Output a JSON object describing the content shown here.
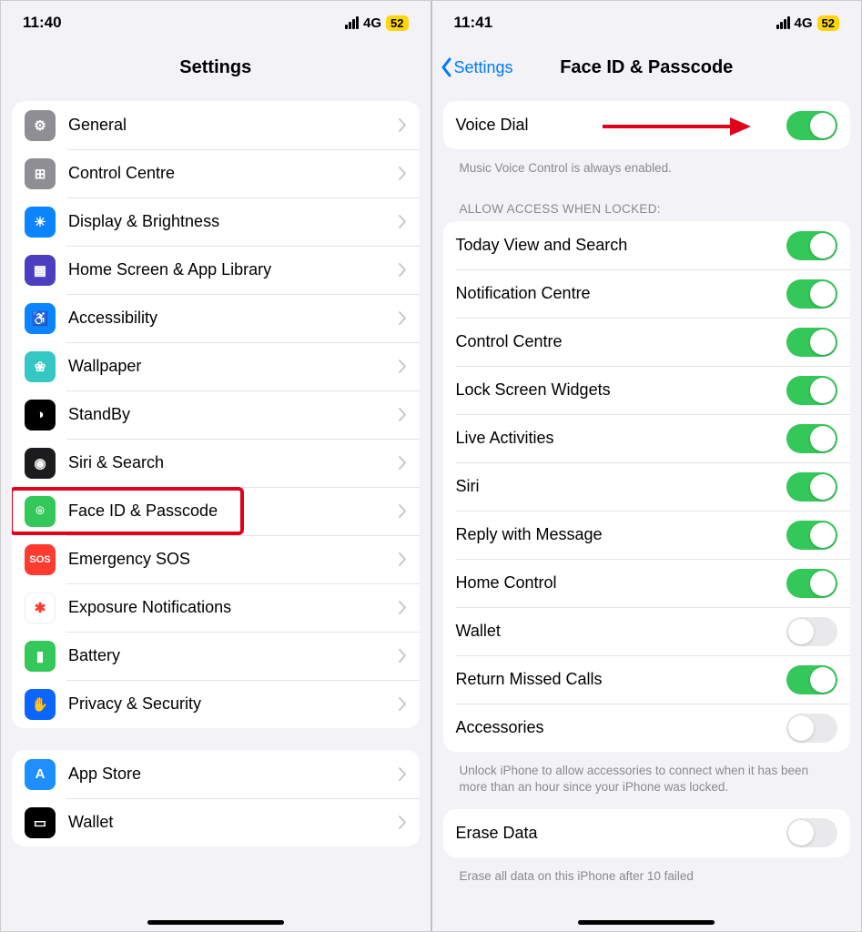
{
  "left": {
    "status": {
      "time": "11:40",
      "network": "4G",
      "battery": "52"
    },
    "title": "Settings",
    "groups": [
      [
        {
          "id": "general",
          "label": "General",
          "icon": "gear-icon",
          "cls": "ic-general",
          "glyph": "⚙"
        },
        {
          "id": "control-centre",
          "label": "Control Centre",
          "icon": "sliders-icon",
          "cls": "ic-control",
          "glyph": "⊞"
        },
        {
          "id": "display",
          "label": "Display & Brightness",
          "icon": "sun-icon",
          "cls": "ic-display",
          "glyph": "☀"
        },
        {
          "id": "home-screen",
          "label": "Home Screen & App Library",
          "icon": "grid-icon",
          "cls": "ic-home",
          "glyph": "▦"
        },
        {
          "id": "accessibility",
          "label": "Accessibility",
          "icon": "person-icon",
          "cls": "ic-access",
          "glyph": "♿"
        },
        {
          "id": "wallpaper",
          "label": "Wallpaper",
          "icon": "flower-icon",
          "cls": "ic-wall",
          "glyph": "❀"
        },
        {
          "id": "standby",
          "label": "StandBy",
          "icon": "clock-icon",
          "cls": "ic-standby",
          "glyph": "◑"
        },
        {
          "id": "siri",
          "label": "Siri & Search",
          "icon": "siri-icon",
          "cls": "ic-siri",
          "glyph": "◉"
        },
        {
          "id": "faceid",
          "label": "Face ID & Passcode",
          "icon": "faceid-icon",
          "cls": "ic-faceid",
          "glyph": "⌾",
          "highlighted": true
        },
        {
          "id": "sos",
          "label": "Emergency SOS",
          "icon": "sos-icon",
          "cls": "ic-sos",
          "glyph": "SOS"
        },
        {
          "id": "exposure",
          "label": "Exposure Notifications",
          "icon": "virus-icon",
          "cls": "ic-exposure",
          "glyph": "✱"
        },
        {
          "id": "battery",
          "label": "Battery",
          "icon": "battery-icon",
          "cls": "ic-battery",
          "glyph": "▮"
        },
        {
          "id": "privacy",
          "label": "Privacy & Security",
          "icon": "hand-icon",
          "cls": "ic-privacy",
          "glyph": "✋"
        }
      ],
      [
        {
          "id": "appstore",
          "label": "App Store",
          "icon": "appstore-icon",
          "cls": "ic-appstore",
          "glyph": "A"
        },
        {
          "id": "wallet",
          "label": "Wallet",
          "icon": "wallet-icon",
          "cls": "ic-wallet",
          "glyph": "▭"
        }
      ]
    ]
  },
  "right": {
    "status": {
      "time": "11:41",
      "network": "4G",
      "battery": "52"
    },
    "back_label": "Settings",
    "title": "Face ID & Passcode",
    "voice_dial": {
      "label": "Voice Dial",
      "on": true
    },
    "voice_dial_footer": "Music Voice Control is always enabled.",
    "allow_header": "ALLOW ACCESS WHEN LOCKED:",
    "allow_items": [
      {
        "id": "today-view",
        "label": "Today View and Search",
        "on": true
      },
      {
        "id": "notification-centre",
        "label": "Notification Centre",
        "on": true
      },
      {
        "id": "control-centre",
        "label": "Control Centre",
        "on": true
      },
      {
        "id": "lock-widgets",
        "label": "Lock Screen Widgets",
        "on": true
      },
      {
        "id": "live-activities",
        "label": "Live Activities",
        "on": true
      },
      {
        "id": "siri",
        "label": "Siri",
        "on": true
      },
      {
        "id": "reply-message",
        "label": "Reply with Message",
        "on": true
      },
      {
        "id": "home-control",
        "label": "Home Control",
        "on": true
      },
      {
        "id": "wallet",
        "label": "Wallet",
        "on": false
      },
      {
        "id": "return-missed",
        "label": "Return Missed Calls",
        "on": true
      },
      {
        "id": "accessories",
        "label": "Accessories",
        "on": false
      }
    ],
    "accessories_footer": "Unlock iPhone to allow accessories to connect when it has been more than an hour since your iPhone was locked.",
    "erase": {
      "label": "Erase Data",
      "on": false
    },
    "erase_footer": "Erase all data on this iPhone after 10 failed"
  }
}
